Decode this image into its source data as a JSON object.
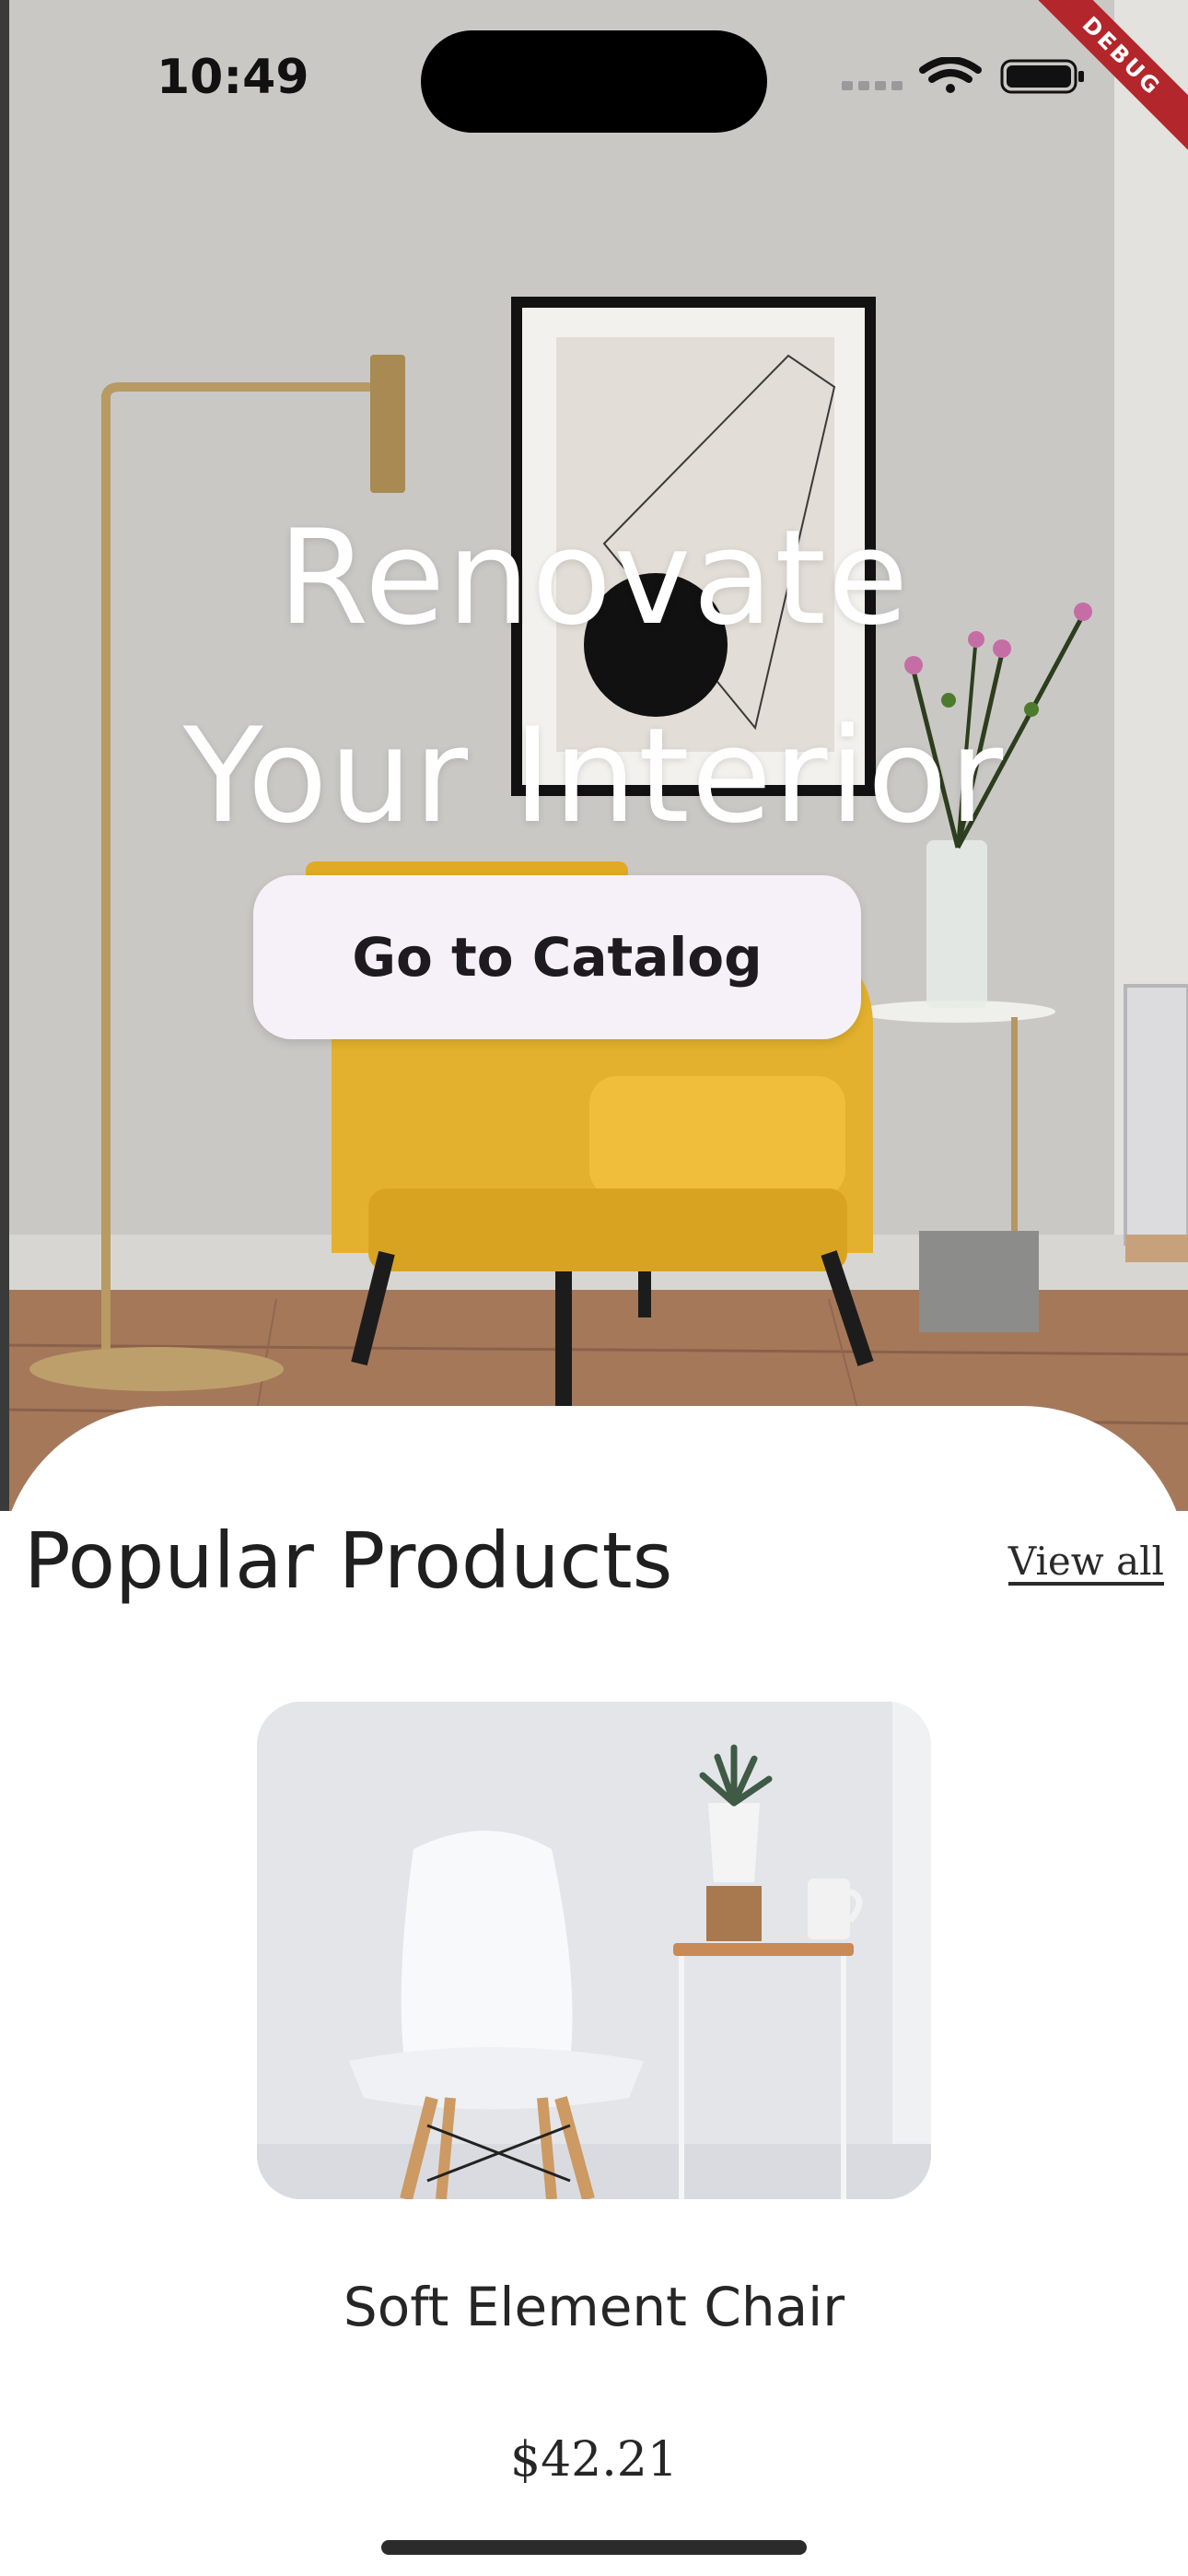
{
  "status_bar": {
    "time": "10:49",
    "debug_banner": "DEBUG"
  },
  "hero": {
    "title_line_1": "Renovate",
    "title_line_2": "Your Interior",
    "cta_label": "Go to Catalog",
    "image_icon": "living-room-photo"
  },
  "popular": {
    "title": "Popular Products",
    "view_all_label": "View all",
    "products": [
      {
        "name": "Soft Element Chair",
        "price": "$42.21",
        "image_icon": "white-chair-photo"
      }
    ]
  },
  "colors": {
    "button_bg": "#f6f1f8",
    "accent_chair": "#e3b12d",
    "text": "#222222",
    "debug": "#b3262b"
  }
}
